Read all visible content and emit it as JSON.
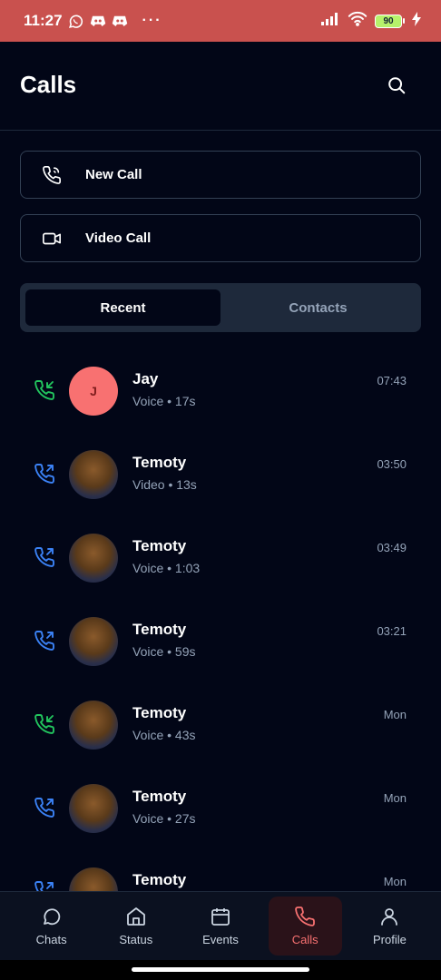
{
  "status_bar": {
    "time": "11:27",
    "battery": "90",
    "dots": "···"
  },
  "header": {
    "title": "Calls"
  },
  "actions": {
    "new_call": "New Call",
    "video_call": "Video Call"
  },
  "tabs": [
    {
      "label": "Recent",
      "active": true
    },
    {
      "label": "Contacts",
      "active": false
    }
  ],
  "calls": [
    {
      "name": "Jay",
      "meta": "Voice • 17s",
      "time": "07:43",
      "direction": "incoming",
      "avatar": "J"
    },
    {
      "name": "Temoty",
      "meta": "Video • 13s",
      "time": "03:50",
      "direction": "outgoing",
      "avatar": ""
    },
    {
      "name": "Temoty",
      "meta": "Voice • 1:03",
      "time": "03:49",
      "direction": "outgoing",
      "avatar": ""
    },
    {
      "name": "Temoty",
      "meta": "Voice • 59s",
      "time": "03:21",
      "direction": "outgoing",
      "avatar": ""
    },
    {
      "name": "Temoty",
      "meta": "Voice • 43s",
      "time": "Mon",
      "direction": "incoming",
      "avatar": ""
    },
    {
      "name": "Temoty",
      "meta": "Voice • 27s",
      "time": "Mon",
      "direction": "outgoing",
      "avatar": ""
    },
    {
      "name": "Temoty",
      "meta": "",
      "time": "Mon",
      "direction": "outgoing",
      "avatar": ""
    }
  ],
  "nav": [
    {
      "label": "Chats",
      "icon": "chat-icon"
    },
    {
      "label": "Status",
      "icon": "home-icon"
    },
    {
      "label": "Events",
      "icon": "calendar-icon"
    },
    {
      "label": "Calls",
      "icon": "phone-icon",
      "active": true
    },
    {
      "label": "Profile",
      "icon": "user-icon"
    }
  ],
  "colors": {
    "incoming": "#22c55e",
    "outgoing": "#3b82f6",
    "accent": "#f87171"
  }
}
